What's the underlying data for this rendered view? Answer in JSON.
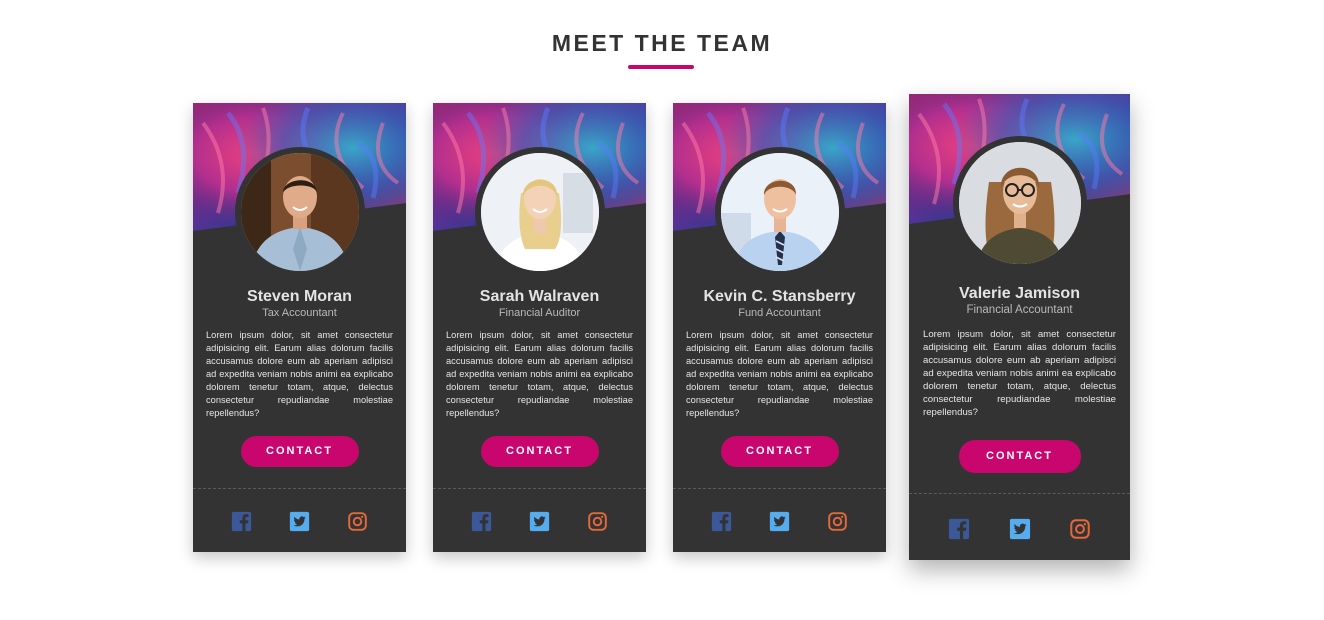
{
  "section": {
    "title": "MEET THE TEAM"
  },
  "colors": {
    "accent": "#c8066e",
    "card_background": "#333333",
    "facebook": "#3b5998",
    "twitter": "#55acee",
    "instagram": "#e4683a"
  },
  "icons": {
    "facebook": "facebook-icon",
    "twitter": "twitter-icon",
    "instagram": "instagram-icon"
  },
  "team": [
    {
      "name": "Steven Moran",
      "role": "Tax Accountant",
      "bio": "Lorem ipsum dolor, sit amet consectetur adipisicing elit. Earum alias dolorum facilis accusamus dolore eum ab aperiam adipisci ad expedita veniam nobis animi ea explicabo dolorem tenetur totam, atque, delectus consectetur repudiandae molestiae repellendus?",
      "contact_label": "CONTACT"
    },
    {
      "name": "Sarah Walraven",
      "role": "Financial Auditor",
      "bio": "Lorem ipsum dolor, sit amet consectetur adipisicing elit. Earum alias dolorum facilis accusamus dolore eum ab aperiam adipisci ad expedita veniam nobis animi ea explicabo dolorem tenetur totam, atque, delectus consectetur repudiandae molestiae repellendus?",
      "contact_label": "CONTACT"
    },
    {
      "name": "Kevin C. Stansberry",
      "role": "Fund Accountant",
      "bio": "Lorem ipsum dolor, sit amet consectetur adipisicing elit. Earum alias dolorum facilis accusamus dolore eum ab aperiam adipisci ad expedita veniam nobis animi ea explicabo dolorem tenetur totam, atque, delectus consectetur repudiandae molestiae repellendus?",
      "contact_label": "CONTACT"
    },
    {
      "name": "Valerie Jamison",
      "role": "Financial Accountant",
      "bio": "Lorem ipsum dolor, sit amet consectetur adipisicing elit. Earum alias dolorum facilis accusamus dolore eum ab aperiam adipisci ad expedita veniam nobis animi ea explicabo dolorem tenetur totam, atque, delectus consectetur repudiandae molestiae repellendus?",
      "contact_label": "CONTACT"
    }
  ]
}
